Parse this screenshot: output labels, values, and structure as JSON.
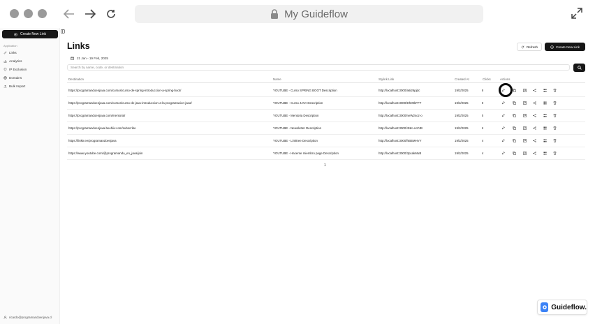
{
  "browser": {
    "address": "My Guideflow"
  },
  "sidebar": {
    "create_button": "Create New Link",
    "section_label": "Application",
    "items": [
      {
        "label": "Links",
        "icon": "link-icon"
      },
      {
        "label": "Analytics",
        "icon": "chart-icon"
      },
      {
        "label": "IP Exclusion",
        "icon": "shield-icon"
      },
      {
        "label": "Domains",
        "icon": "globe-icon"
      },
      {
        "label": "Bulk Import",
        "icon": "upload-icon"
      }
    ],
    "user": "ricardo@programandoenjava.cl"
  },
  "main": {
    "title": "Links",
    "refresh_label": "Refresh",
    "create_label": "Create New Link",
    "date_range": "21 Jan - 19 Feb, 2025",
    "search_placeholder": "Search by name, code, or destination",
    "columns": [
      "Destination",
      "Name",
      "Stylink Link",
      "Created At",
      "Clicks",
      "Actions"
    ],
    "rows": [
      {
        "destination": "https://programandoenjava.com/cursos/curso-de-spring-introduccion-a-spring-boot/",
        "name": "YOUTUBE - Curso SPRING BOOT Description",
        "link": "http://localhost:3000/a6i26pjdc",
        "created": "19/2/2025",
        "clicks": "8"
      },
      {
        "destination": "https://programandoenjava.com/cursos/curso-de-java-introduccion-a-la-programacion-java/",
        "name": "YOUTUBE - Curso JAVA Description",
        "link": "http://localhost:3000/DhIMkFFT",
        "created": "19/2/2025",
        "clicks": "8"
      },
      {
        "destination": "https://programandoenjava.com/mentoria/",
        "name": "YOUTUBE - Mentoria Description",
        "link": "http://localhost:3000/neW2soz-o",
        "created": "19/2/2025",
        "clicks": "5"
      },
      {
        "destination": "https://programandoenjava.beehiiv.com/subscribe",
        "name": "YOUTUBE - Newsletter Description",
        "link": "http://localhost:3000/4NK-ecZJB",
        "created": "19/2/2025",
        "clicks": "6"
      },
      {
        "destination": "https://linktr.ee/programandoenjava",
        "name": "YOUTUBE - Linktree Description",
        "link": "http://localhost:3000/hBBMHVY",
        "created": "19/2/2025",
        "clicks": "4"
      },
      {
        "destination": "https://www.youtube.com/@programando_en_java/join",
        "name": "YOUTUBE - Hacerse miembro page Description",
        "link": "http://localhost:3000/3pxakMuB",
        "created": "19/2/2025",
        "clicks": "4"
      }
    ],
    "page_number": "1"
  },
  "badge": {
    "label": "Guideflow."
  }
}
